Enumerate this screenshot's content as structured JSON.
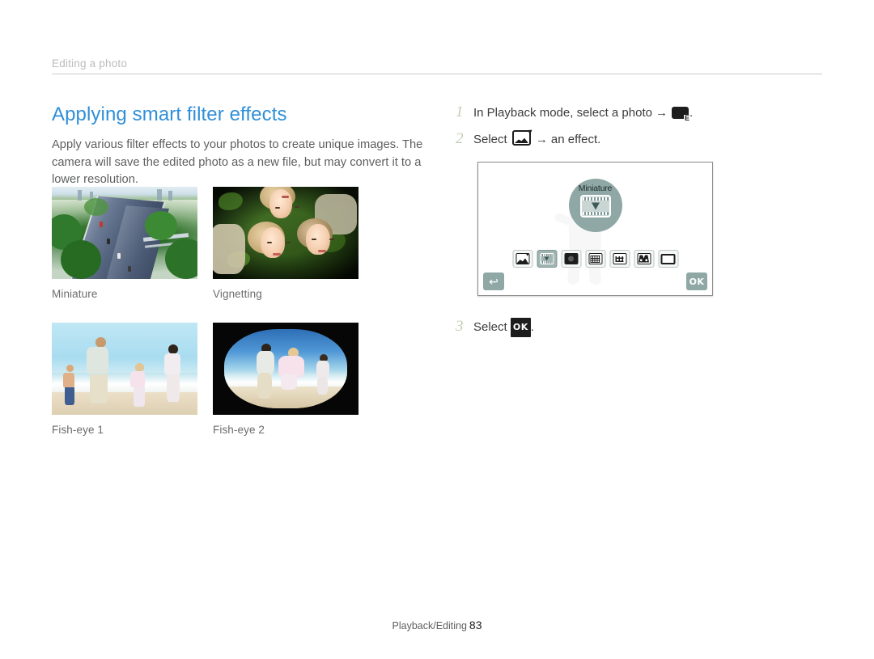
{
  "running_head": "Editing a photo",
  "section": {
    "title": "Applying smart filter effects",
    "intro": "Apply various filter effects to your photos to create unique images. The camera will save the edited photo as a new file, but may convert it to a lower resolution."
  },
  "samples": [
    {
      "caption": "Miniature"
    },
    {
      "caption": "Vignetting"
    },
    {
      "caption": "Fish-eye 1"
    },
    {
      "caption": "Fish-eye 2"
    }
  ],
  "steps": [
    {
      "number": "1",
      "text_before": "In Playback mode, select a photo",
      "arrow": "→",
      "icon": "playback-edit-icon",
      "text_after": "."
    },
    {
      "number": "2",
      "text_before": "Select",
      "arrow": "→",
      "icon": "smart-filter-icon",
      "text_after": "an effect."
    },
    {
      "number": "3",
      "text_before": "Select",
      "icon": "ok-icon",
      "ok_label": "OK",
      "text_after": "."
    }
  ],
  "lcd": {
    "selected_effect": "Miniature",
    "back_glyph": "↩",
    "ok_label": "OK",
    "effects": [
      {
        "name": "smart-filter",
        "selected": false
      },
      {
        "name": "miniature",
        "selected": true
      },
      {
        "name": "vignetting",
        "selected": false
      },
      {
        "name": "fish-eye-1",
        "selected": false
      },
      {
        "name": "fish-eye-2",
        "selected": false
      },
      {
        "name": "sketch",
        "selected": false
      },
      {
        "name": "normal",
        "selected": false
      }
    ]
  },
  "footer": {
    "label": "Playback/Editing",
    "page": "83"
  },
  "colors": {
    "heading": "#2f8fd8",
    "step_number": "#c2cdb4",
    "lcd_accent": "#8fa8a6",
    "rule": "#c9ccc8"
  }
}
